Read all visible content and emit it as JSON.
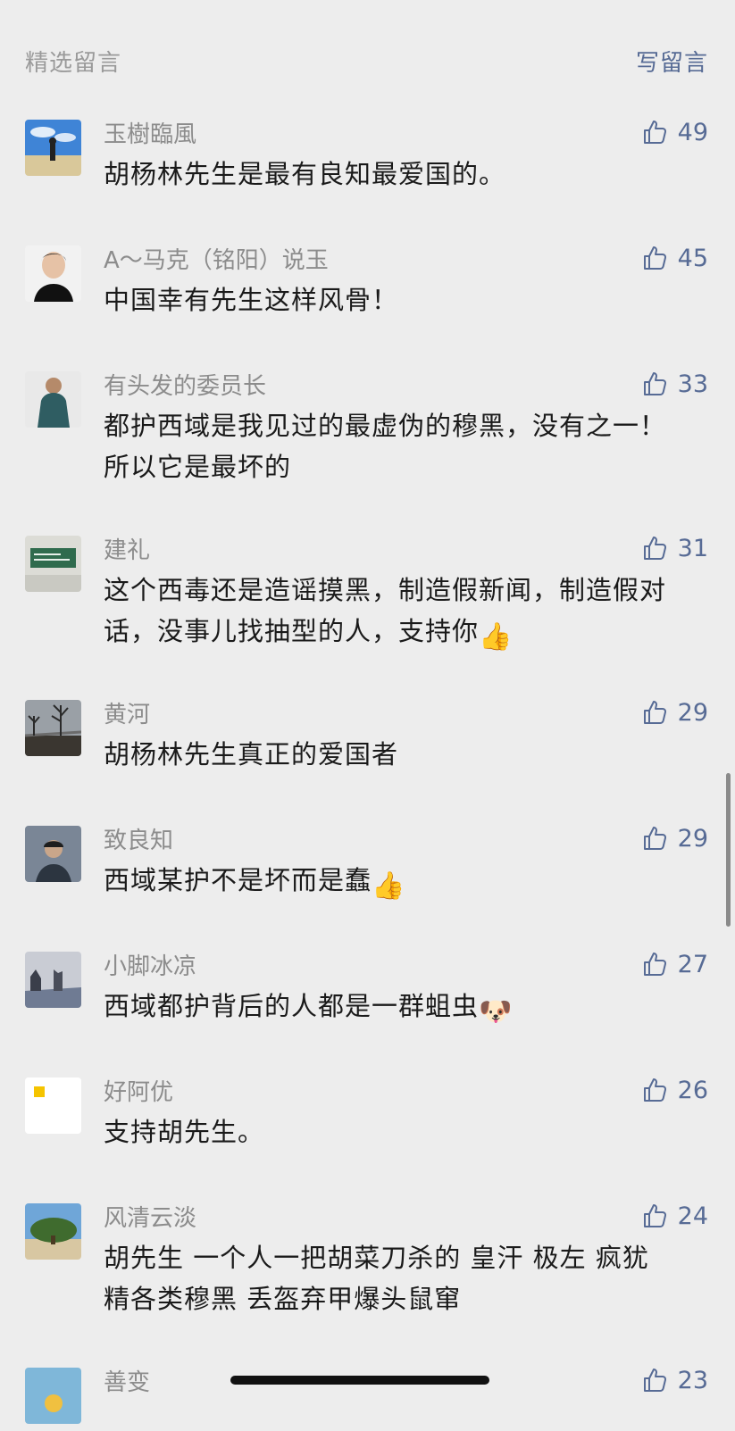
{
  "header": {
    "title": "精选留言",
    "write_label": "写留言"
  },
  "colors": {
    "background": "#ededed",
    "link": "#576b95",
    "meta_text": "#8c8c8c",
    "body_text": "#1a1a1a"
  },
  "comments": [
    {
      "name": "玉樹臨風",
      "text": "胡杨林先生是最有良知最爱国的。",
      "likes": "49",
      "emoji": "",
      "avatar_icon": "avatar-photo"
    },
    {
      "name": "A～马克（铭阳）说玉",
      "text": "中国幸有先生这样风骨！",
      "likes": "45",
      "emoji": "",
      "avatar_icon": "avatar-photo"
    },
    {
      "name": "有头发的委员长",
      "text": "都护西域是我见过的最虚伪的穆黑，没有之一！所以它是最坏的",
      "likes": "33",
      "emoji": "",
      "avatar_icon": "avatar-photo"
    },
    {
      "name": "建礼",
      "text": "这个西毒还是造谣摸黑，制造假新闻，制造假对话，没事儿找抽型的人，支持你",
      "likes": "31",
      "emoji": "👍",
      "avatar_icon": "avatar-photo"
    },
    {
      "name": "黄河",
      "text": "胡杨林先生真正的爱国者",
      "likes": "29",
      "emoji": "",
      "avatar_icon": "avatar-photo"
    },
    {
      "name": "致良知",
      "text": "西域某护不是坏而是蠢",
      "likes": "29",
      "emoji": "👍",
      "avatar_icon": "avatar-photo"
    },
    {
      "name": "小脚冰凉",
      "text": "西域都护背后的人都是一群蛆虫",
      "likes": "27",
      "emoji": "🐶",
      "avatar_icon": "avatar-photo"
    },
    {
      "name": "好阿优",
      "text": "支持胡先生。",
      "likes": "26",
      "emoji": "",
      "avatar_icon": "avatar-photo"
    },
    {
      "name": "风清云淡",
      "text": "胡先生 一个人一把胡菜刀杀的 皇汗 极左 疯犹精各类穆黑 丢盔弃甲爆头鼠窜",
      "likes": "24",
      "emoji": "",
      "avatar_icon": "avatar-photo"
    },
    {
      "name": "善变",
      "text": "",
      "likes": "23",
      "emoji": "",
      "avatar_icon": "avatar-photo"
    }
  ]
}
